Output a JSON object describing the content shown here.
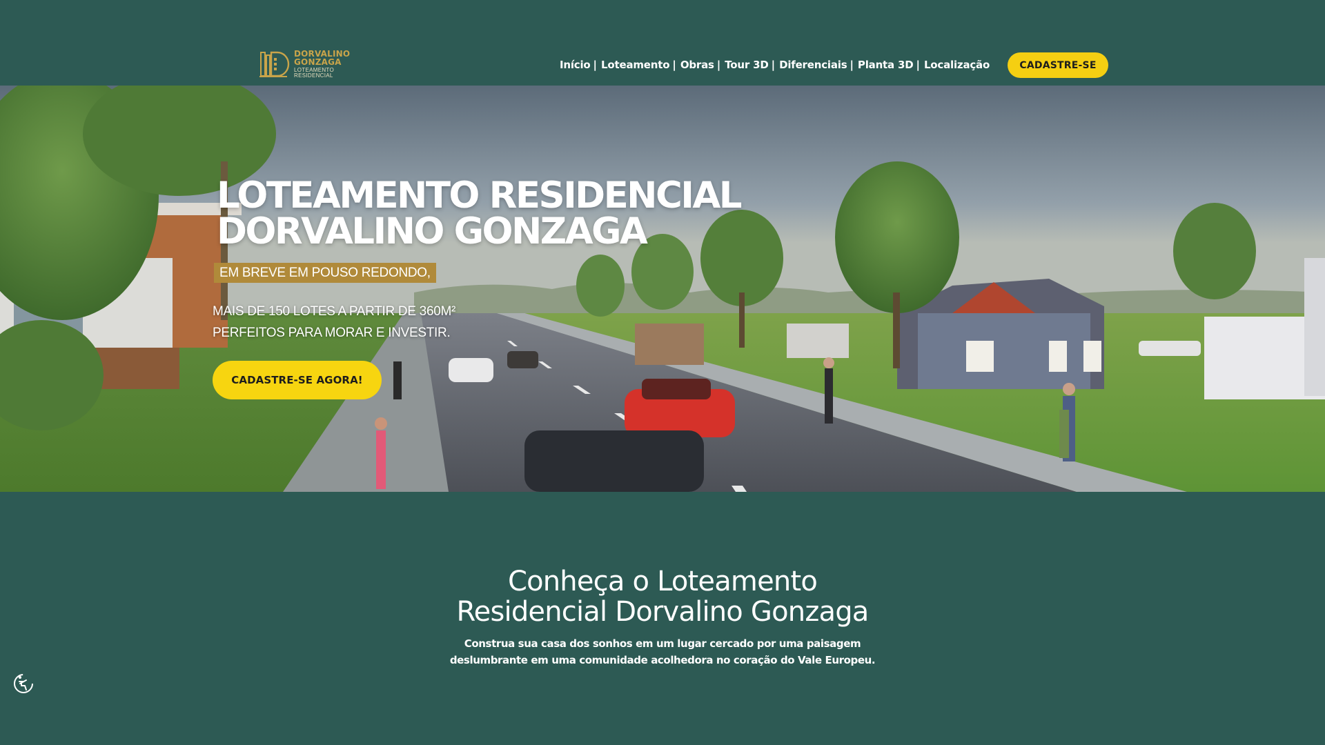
{
  "header": {
    "logo": {
      "name_line1": "DORVALINO",
      "name_line2": "GONZAGA",
      "sub_line1": "LOTEAMENTO",
      "sub_line2": "RESIDENCIAL",
      "icon": "building-d-logo"
    },
    "nav": [
      {
        "label": "Início"
      },
      {
        "label": "Loteamento"
      },
      {
        "label": "Obras"
      },
      {
        "label": "Tour 3D"
      },
      {
        "label": "Diferenciais"
      },
      {
        "label": "Planta 3D"
      },
      {
        "label": "Localização"
      }
    ],
    "separator": "|",
    "cta_label": "CADASTRE-SE"
  },
  "hero": {
    "title_line1": "LOTEAMENTO RESIDENCIAL",
    "title_line2": "DORVALINO GONZAGA",
    "badge": "EM BREVE EM POUSO REDONDO,",
    "desc_line1": "MAIS DE 150 LOTES A PARTIR DE 360M²",
    "desc_line2": "PERFEITOS PARA MORAR E INVESTIR.",
    "cta_label": "CADASTRE-SE AGORA!"
  },
  "about": {
    "title_line1": "Conheça o Loteamento",
    "title_line2": "Residencial Dorvalino Gonzaga",
    "desc_line1": "Construa sua casa dos sonhos em um lugar cercado por uma paisagem",
    "desc_line2": "deslumbrante em uma comunidade acolhedora no coração do Vale Europeu."
  },
  "accessibility": {
    "icon": "accessibility-icon"
  },
  "colors": {
    "background": "#2d5a54",
    "accent_yellow": "#f5cf12",
    "gold": "#b08a3a",
    "logo_gold": "#c9a44a",
    "text_white": "#ffffff"
  }
}
